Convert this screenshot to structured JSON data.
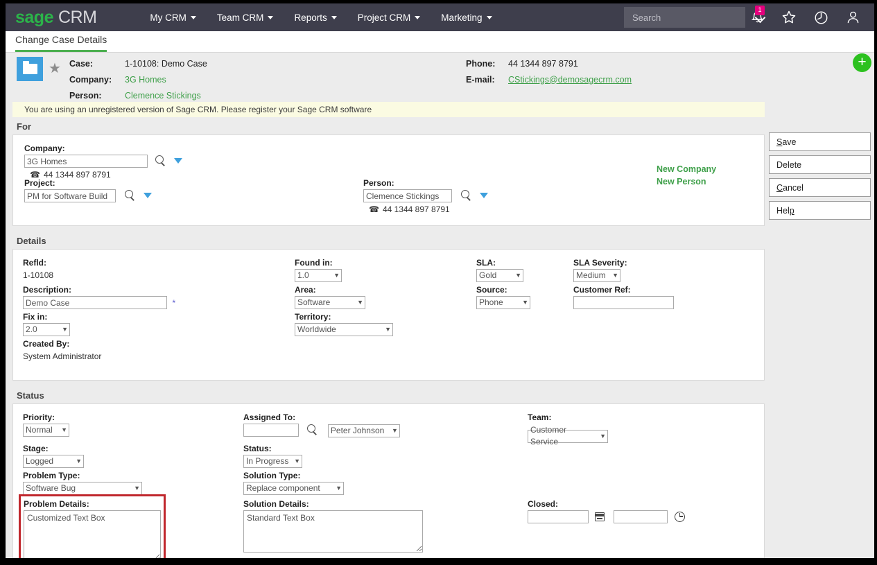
{
  "app": {
    "logo_sage": "sage",
    "logo_crm": "CRM"
  },
  "nav": {
    "items": [
      {
        "label": "My CRM"
      },
      {
        "label": "Team CRM"
      },
      {
        "label": "Reports"
      },
      {
        "label": "Project CRM"
      },
      {
        "label": "Marketing"
      }
    ],
    "search_placeholder": "Search",
    "search_value": "",
    "notification_count": "1"
  },
  "tab": {
    "label": "Change Case Details"
  },
  "summary": {
    "case_label": "Case:",
    "case_value": "1-10108: Demo Case",
    "company_label": "Company:",
    "company_value": "3G Homes",
    "person_label": "Person:",
    "person_value": "Clemence Stickings",
    "phone_label": "Phone:",
    "phone_value": "44 1344 897 8791",
    "email_label": "E-mail:",
    "email_value": "CStickings@demosagecrm.com",
    "add_button": "+"
  },
  "warning": {
    "message": "You are using an unregistered version of Sage CRM. Please register your Sage CRM software"
  },
  "for_section": {
    "heading": "For",
    "company_label": "Company:",
    "company_value": "3G Homes",
    "company_phone": "44 1344 897 8791",
    "project_label": "Project:",
    "project_value": "PM for Software Build",
    "person_label": "Person:",
    "person_value": "Clemence Stickings",
    "person_phone": "44 1344 897 8791",
    "new_company_link": "New Company",
    "new_person_link": "New Person"
  },
  "buttons": {
    "save": "Save",
    "save_accel": "S",
    "save_rest": "ave",
    "delete": "Delete",
    "delete_accel": "D",
    "delete_rest": "elete",
    "cancel": "Cancel",
    "cancel_accel": "C",
    "cancel_rest": "ancel",
    "help": "Help",
    "help_pre": "Hel",
    "help_accel": "p"
  },
  "details_section": {
    "heading": "Details",
    "refid_label": "Refld:",
    "refid_value": "1-10108",
    "description_label": "Description:",
    "description_value": "Demo Case",
    "description_required": "*",
    "fixin_label": "Fix in:",
    "fixin_value": "2.0",
    "fixin_options": [
      "2.0"
    ],
    "createdby_label": "Created By:",
    "createdby_value": "System Administrator",
    "foundin_label": "Found in:",
    "foundin_value": "1.0",
    "foundin_options": [
      "1.0"
    ],
    "area_label": "Area:",
    "area_value": "Software",
    "area_options": [
      "Software"
    ],
    "territory_label": "Territory:",
    "territory_value": "Worldwide",
    "territory_options": [
      "Worldwide"
    ],
    "sla_label": "SLA:",
    "sla_value": "Gold",
    "sla_options": [
      "Gold"
    ],
    "source_label": "Source:",
    "source_value": "Phone",
    "source_options": [
      "Phone"
    ],
    "sla_severity_label": "SLA Severity:",
    "sla_severity_value": "Medium",
    "sla_severity_options": [
      "Medium"
    ],
    "customer_ref_label": "Customer Ref:",
    "customer_ref_value": ""
  },
  "status_section": {
    "heading": "Status",
    "priority_label": "Priority:",
    "priority_value": "Normal",
    "priority_options": [
      "Normal"
    ],
    "stage_label": "Stage:",
    "stage_value": "Logged",
    "stage_options": [
      "Logged"
    ],
    "problem_type_label": "Problem Type:",
    "problem_type_value": "Software Bug",
    "problem_type_options": [
      "Software Bug"
    ],
    "problem_details_label": "Problem Details:",
    "problem_details_value": "Customized Text Box",
    "assigned_to_label": "Assigned To:",
    "assigned_to_search_value": "",
    "assigned_to_value": "Peter Johnson",
    "assigned_to_options": [
      "Peter Johnson"
    ],
    "status_label": "Status:",
    "status_value": "In Progress",
    "status_options": [
      "In Progress"
    ],
    "solution_type_label": "Solution Type:",
    "solution_type_value": "Replace component",
    "solution_type_options": [
      "Replace component"
    ],
    "solution_details_label": "Solution Details:",
    "solution_details_value": "Standard Text Box",
    "team_label": "Team:",
    "team_value": "Customer Service",
    "team_options": [
      "Customer Service"
    ],
    "closed_label": "Closed:",
    "closed_date_value": "",
    "closed_time_value": ""
  },
  "colors": {
    "nav_bg": "#3e3e4c",
    "sage_green": "#2cb34a",
    "accent_green": "#3fa04a",
    "badge_pink": "#e6007e",
    "highlight_red": "#c0272d",
    "folder_blue": "#3fa0dd"
  }
}
